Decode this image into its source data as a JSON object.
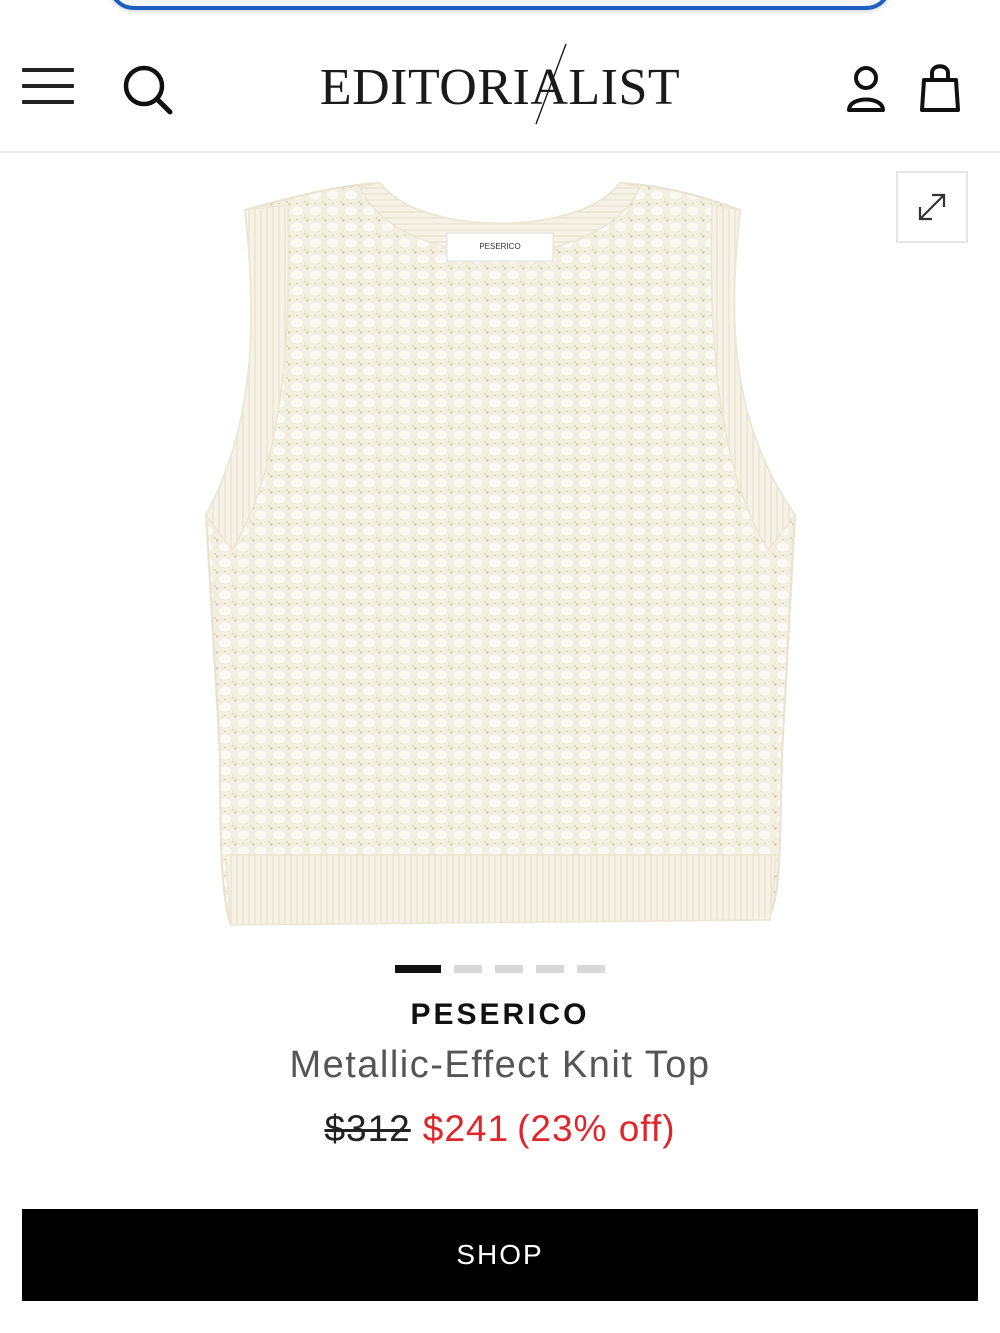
{
  "header": {
    "logo_text": "EDITORIALIST",
    "menu_icon": "hamburger-menu-icon",
    "search_icon": "search-icon",
    "account_icon": "user-icon",
    "bag_icon": "shopping-bag-icon"
  },
  "gallery": {
    "expand_icon": "expand-arrows-icon",
    "label_text": "PESERICO",
    "dots_total": 5,
    "dots_active_index": 0
  },
  "product": {
    "brand": "PESERICO",
    "name": "Metallic-Effect Knit Top",
    "original_price": "$312",
    "sale_price": "$241",
    "discount": "(23% off)"
  },
  "cta": {
    "shop_label": "SHOP"
  },
  "colors": {
    "accent_red": "#e0262b",
    "primary_black": "#000000",
    "browser_bar_blue": "#1f5fbf"
  }
}
